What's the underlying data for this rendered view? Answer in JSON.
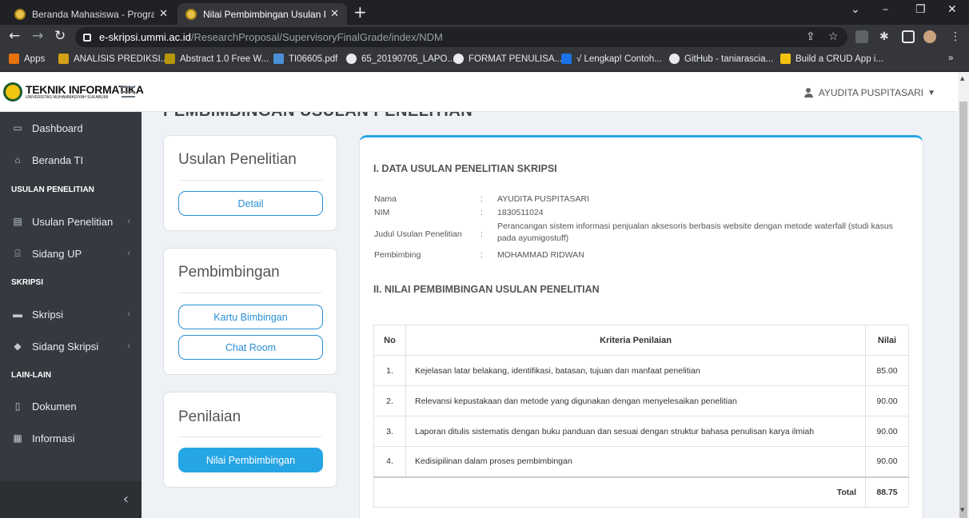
{
  "browser": {
    "tabs": [
      {
        "title": "Beranda Mahasiswa - Program St",
        "active": false
      },
      {
        "title": "Nilai Pembimbingan Usulan Pene",
        "active": true
      }
    ],
    "url_host": "e-skripsi.ummi.ac.id",
    "url_path": "/ResearchProposal/SupervisoryFinalGrade/index/NDM",
    "bookmarks": [
      "Apps",
      "ANALISIS PREDIKSI...",
      "Abstract 1.0 Free W...",
      "TI06605.pdf",
      "65_20190705_LAPO...",
      "FORMAT PENULISA...",
      "√ Lengkap! Contoh...",
      "GitHub - taniarascia...",
      "Build a CRUD App i..."
    ]
  },
  "header": {
    "logo_name": "TEKNIK INFORMATIKA",
    "logo_sub": "UNIVERSITAS MUHAMMADIYAH SUKABUMI",
    "user_name": "AYUDITA PUSPITASARI"
  },
  "sidebar": {
    "items": [
      {
        "label": "Dashboard",
        "icon": "monitor-icon"
      },
      {
        "label": "Beranda TI",
        "icon": "home-icon"
      },
      {
        "label": "Usulan Penelitian",
        "icon": "file-icon"
      },
      {
        "label": "Sidang UP",
        "icon": "bank-icon"
      },
      {
        "label": "Skripsi",
        "icon": "book-icon"
      },
      {
        "label": "Sidang Skripsi",
        "icon": "graduation-cap-icon"
      },
      {
        "label": "Dokumen",
        "icon": "document-icon"
      },
      {
        "label": "Informasi",
        "icon": "newspaper-icon"
      }
    ],
    "headers": [
      "USULAN PENELITIAN",
      "SKRIPSI",
      "LAIN-LAIN"
    ]
  },
  "page": {
    "title": "PEMBIMBINGAN USULAN PENELITIAN",
    "cards": {
      "usulan": {
        "title": "Usulan Penelitian",
        "detail_btn": "Detail"
      },
      "pembimbingan": {
        "title": "Pembimbingan",
        "kartu_btn": "Kartu Bimbingan",
        "chat_btn": "Chat Room"
      },
      "penilaian": {
        "title": "Penilaian",
        "nilai_btn": "Nilai Pembimbingan"
      }
    },
    "section1_title": "I. DATA USULAN PENELITIAN SKRIPSI",
    "info": {
      "nama_label": "Nama",
      "nama": "AYUDITA PUSPITASARI",
      "nim_label": "NIM",
      "nim": "1830511024",
      "judul_label": "Judul Usulan Penelitian",
      "judul": "Perancangan sistem informasi penjualan aksesoris berbasis website dengan metode waterfall (studi kasus pada ayumigostuff)",
      "pembimbing_label": "Pembimbing",
      "pembimbing": "MOHAMMAD RIDWAN",
      "colon": ":"
    },
    "section2_title": "II. NILAI PEMBIMBINGAN USULAN PENELITIAN",
    "table": {
      "headers": {
        "no": "No",
        "kriteria": "Kriteria Penilaian",
        "nilai": "Nilai"
      },
      "rows": [
        {
          "no": "1.",
          "kriteria": "Kejelasan latar belakang, identifikasi, batasan, tujuan dan manfaat penelitian",
          "nilai": "85.00"
        },
        {
          "no": "2.",
          "kriteria": "Relevansi kepustakaan dan metode yang digunakan dengan menyelesaikan penelitian",
          "nilai": "90.00"
        },
        {
          "no": "3.",
          "kriteria": "Laporan ditulis sistematis dengan buku panduan dan sesuai dengan struktur bahasa penulisan karya ilmiah",
          "nilai": "90.00"
        },
        {
          "no": "4.",
          "kriteria": "Kedisipilinan dalam proses pembimbingan",
          "nilai": "90.00"
        }
      ],
      "total_label": "Total",
      "total_value": "88.75"
    }
  }
}
